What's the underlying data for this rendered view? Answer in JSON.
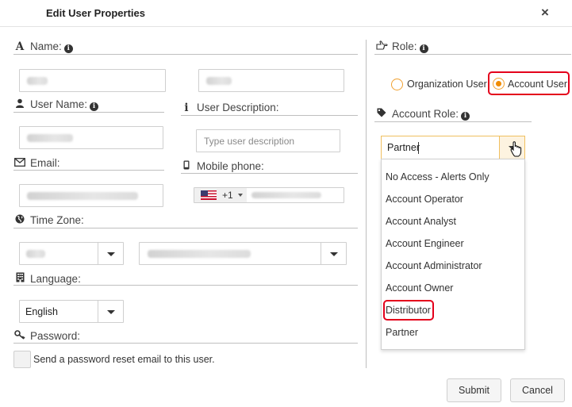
{
  "dialog": {
    "title": "Edit User Properties",
    "close_label": "×"
  },
  "form": {
    "name_label": "Name:",
    "user_name_label": "User Name:",
    "user_description_label": "User Description:",
    "user_description_placeholder": "Type user description",
    "email_label": "Email:",
    "mobile_phone_label": "Mobile phone:",
    "phone_country_code": "+1",
    "time_zone_label": "Time Zone:",
    "language_label": "Language:",
    "language_value": "English",
    "password_label": "Password:",
    "password_reset_label": "Send a password reset email to this user."
  },
  "role": {
    "label": "Role:",
    "options": [
      {
        "label": "Organization User",
        "selected": false
      },
      {
        "label": "Account User",
        "selected": true
      }
    ],
    "account_role_label": "Account Role:",
    "account_role_value": "Partner",
    "account_role_options": [
      "No Access - Alerts Only",
      "Account Operator",
      "Account Analyst",
      "Account Engineer",
      "Account Administrator",
      "Account Owner",
      "Distributor",
      "Partner"
    ],
    "highlighted_option": "Distributor"
  },
  "buttons": {
    "submit": "Submit",
    "cancel": "Cancel"
  },
  "colors": {
    "radio_accent": "#f08c00",
    "highlight_outline": "#e4001b",
    "combo_border": "#f0c060"
  },
  "icons": {
    "name": "font-letter-icon",
    "user_name": "user-icon",
    "user_description": "info-i-icon",
    "email": "envelope-icon",
    "mobile_phone": "mobile-icon",
    "time_zone": "globe-icon",
    "language": "building-icon",
    "password": "key-icon",
    "role": "hand-pointer-icon",
    "account_role": "tag-icon"
  }
}
